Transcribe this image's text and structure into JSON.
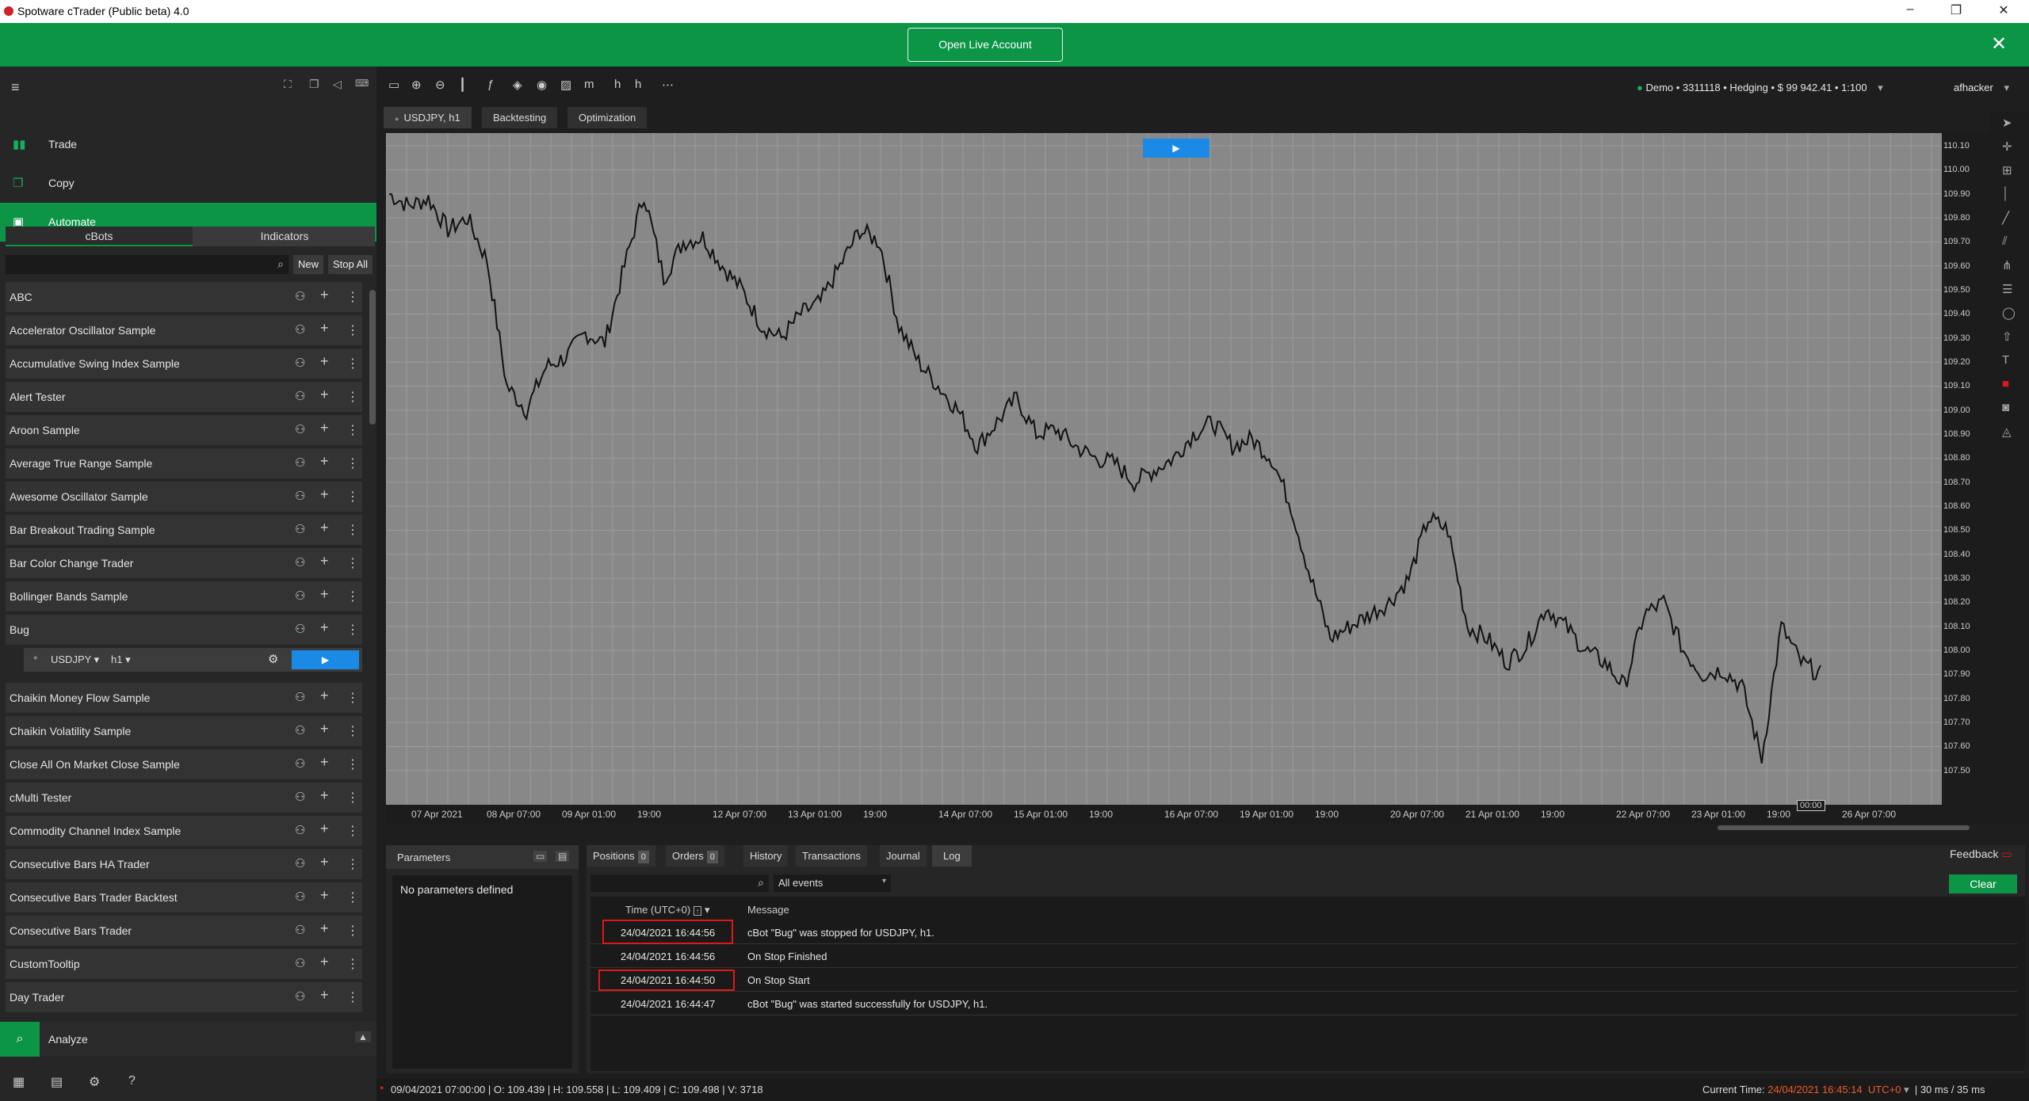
{
  "window": {
    "title": "Spotware cTrader (Public beta) 4.0",
    "minimize": "–",
    "restore": "❐",
    "close": "✕"
  },
  "banner": {
    "button": "Open Live Account",
    "close": "✕"
  },
  "nav": {
    "trade": "Trade",
    "copy": "Copy",
    "automate": "Automate",
    "analyze": "Analyze"
  },
  "subtabs": {
    "cbots": "cBots",
    "indicators": "Indicators"
  },
  "buttons": {
    "new": "New",
    "stop_all": "Stop All"
  },
  "bots": [
    "ABC",
    "Accelerator Oscillator Sample",
    "Accumulative Swing Index Sample",
    "Alert Tester",
    "Aroon Sample",
    "Average True Range Sample",
    "Awesome Oscillator Sample",
    "Bar Breakout Trading Sample",
    "Bar Color Change Trader",
    "Bollinger Bands Sample",
    "Bug",
    "Chaikin Money Flow Sample",
    "Chaikin Volatility Sample",
    "Close All On Market Close Sample",
    "cMulti Tester",
    "Commodity Channel Index Sample",
    "Consecutive Bars HA Trader",
    "Consecutive Bars Trader Backtest",
    "Consecutive Bars Trader",
    "CustomTooltip",
    "Day Trader"
  ],
  "instance": {
    "symbol": "USDJPY",
    "timeframe": "h1",
    "play": "▶"
  },
  "account": {
    "summary": "Demo • 3311118 • Hedging • $ 99 942.41 • 1:100",
    "user": "afhacker"
  },
  "chart_tabs": {
    "chart": "USDJPY, h1",
    "backtesting": "Backtesting",
    "optimization": "Optimization"
  },
  "chart_data": {
    "type": "line",
    "symbol": "USDJPY",
    "timeframe": "h1",
    "ylim": [
      107.45,
      110.12
    ],
    "yticks": [
      "110.10",
      "110.00",
      "109.90",
      "109.80",
      "109.70",
      "109.60",
      "109.50",
      "109.40",
      "109.30",
      "109.20",
      "109.10",
      "109.00",
      "108.90",
      "108.80",
      "108.70",
      "108.60",
      "108.50",
      "108.40",
      "108.30",
      "108.20",
      "108.10",
      "108.00",
      "107.90",
      "107.80",
      "107.70",
      "107.60",
      "107.50"
    ],
    "xticks": [
      "07 Apr 2021",
      "08 Apr 07:00",
      "09 Apr 01:00",
      "19:00",
      "12 Apr 07:00",
      "13 Apr 01:00",
      "19:00",
      "14 Apr 07:00",
      "15 Apr 01:00",
      "19:00",
      "16 Apr 07:00",
      "19 Apr 01:00",
      "19:00",
      "20 Apr 07:00",
      "21 Apr 01:00",
      "19:00",
      "22 Apr 07:00",
      "23 Apr 01:00",
      "19:00",
      "26 Apr 07:00"
    ],
    "cursor_label": "00:00",
    "close": [
      109.9,
      109.85,
      109.88,
      109.75,
      109.8,
      109.62,
      109.1,
      109.0,
      109.18,
      109.22,
      109.32,
      109.28,
      109.6,
      109.9,
      109.55,
      109.7,
      109.72,
      109.6,
      109.5,
      109.35,
      109.3,
      109.4,
      109.45,
      109.6,
      109.75,
      109.7,
      109.35,
      109.2,
      109.1,
      109.0,
      108.85,
      108.95,
      109.05,
      108.9,
      108.92,
      108.85,
      108.8,
      108.78,
      108.7,
      108.75,
      108.8,
      108.9,
      108.95,
      108.85,
      108.88,
      108.8,
      108.6,
      108.3,
      108.05,
      108.1,
      108.15,
      108.2,
      108.3,
      108.55,
      108.5,
      108.1,
      108.05,
      107.95,
      108.02,
      108.18,
      108.1,
      108.0,
      107.95,
      107.85,
      108.15,
      108.2,
      108.0,
      107.9,
      107.92,
      107.85,
      107.55,
      108.1,
      107.95,
      107.9
    ],
    "grid": true
  },
  "params": {
    "title": "Parameters",
    "empty": "No parameters defined"
  },
  "log_tabs": {
    "positions": "Positions",
    "positions_count": "0",
    "orders": "Orders",
    "orders_count": "0",
    "history": "History",
    "transactions": "Transactions",
    "journal": "Journal",
    "log": "Log"
  },
  "log_filter": "All events",
  "log_clear": "Clear",
  "log_head": {
    "time": "Time (UTC+0)",
    "message": "Message"
  },
  "log_rows": [
    {
      "time": "24/04/2021 16:44:56",
      "message": "cBot \"Bug\" was stopped for USDJPY, h1."
    },
    {
      "time": "24/04/2021 16:44:56",
      "message": "On Stop Finished"
    },
    {
      "time": "24/04/2021 16:44:50",
      "message": "On Stop Start"
    },
    {
      "time": "24/04/2021 16:44:47",
      "message": "cBot \"Bug\" was started successfully for USDJPY, h1."
    }
  ],
  "feedback": "Feedback",
  "status": {
    "bar": "09/04/2021 07:00:00 | O: 109.439 | H: 109.558 | L: 109.409 | C: 109.498 | V: 3718",
    "current_label": "Current Time:",
    "current_time": "24/04/2021 16:45:14",
    "tz": "UTC+0",
    "latency": "| 30 ms / 35 ms"
  },
  "colors": {
    "accent": "#0c9447",
    "play": "#1a8ae6",
    "highlight": "#e01818"
  }
}
